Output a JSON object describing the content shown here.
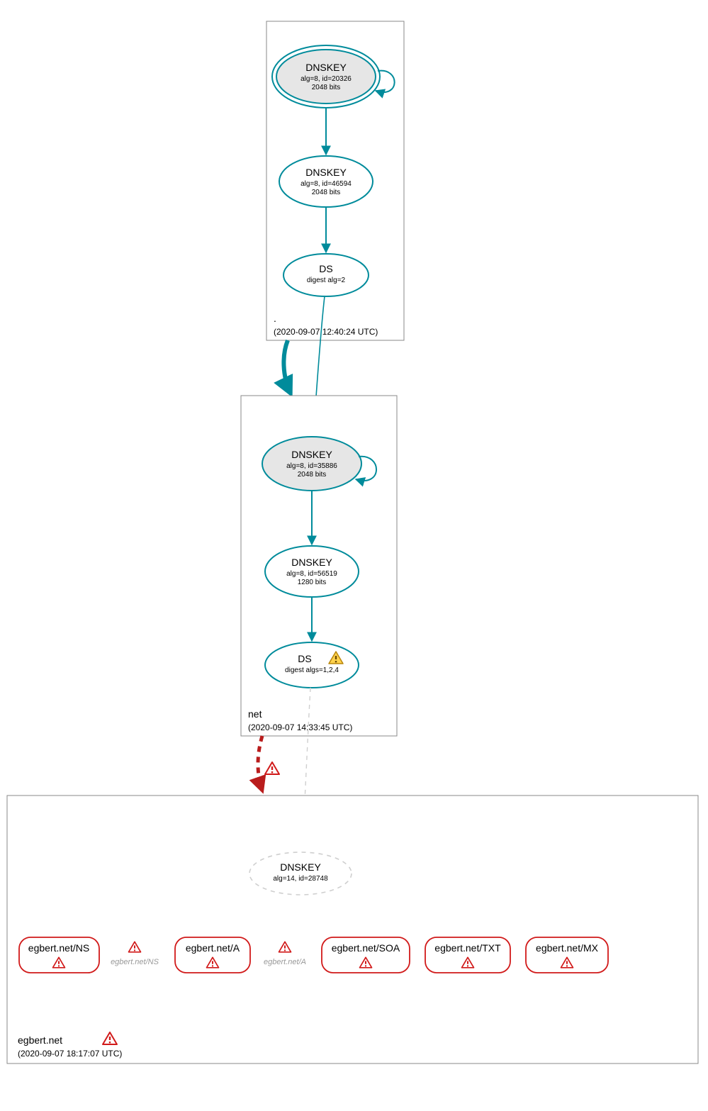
{
  "zones": {
    "root": {
      "name": ".",
      "timestamp": "(2020-09-07 12:40:24 UTC)",
      "nodes": {
        "ksk": {
          "title": "DNSKEY",
          "line2": "alg=8, id=20326",
          "line3": "2048 bits"
        },
        "zsk": {
          "title": "DNSKEY",
          "line2": "alg=8, id=46594",
          "line3": "2048 bits"
        },
        "ds": {
          "title": "DS",
          "line2": "digest alg=2"
        }
      }
    },
    "net": {
      "name": "net",
      "timestamp": "(2020-09-07 14:33:45 UTC)",
      "nodes": {
        "ksk": {
          "title": "DNSKEY",
          "line2": "alg=8, id=35886",
          "line3": "2048 bits"
        },
        "zsk": {
          "title": "DNSKEY",
          "line2": "alg=8, id=56519",
          "line3": "1280 bits"
        },
        "ds": {
          "title": "DS",
          "line2": "digest algs=1,2,4"
        }
      }
    },
    "egbert": {
      "name": "egbert.net",
      "timestamp": "(2020-09-07 18:17:07 UTC)",
      "nodes": {
        "key": {
          "title": "DNSKEY",
          "line2": "alg=14, id=28748"
        }
      },
      "rrs": {
        "ns": "egbert.net/NS",
        "a": "egbert.net/A",
        "soa": "egbert.net/SOA",
        "txt": "egbert.net/TXT",
        "mx": "egbert.net/MX"
      },
      "ghosts": {
        "ns": "egbert.net/NS",
        "a": "egbert.net/A"
      }
    }
  }
}
